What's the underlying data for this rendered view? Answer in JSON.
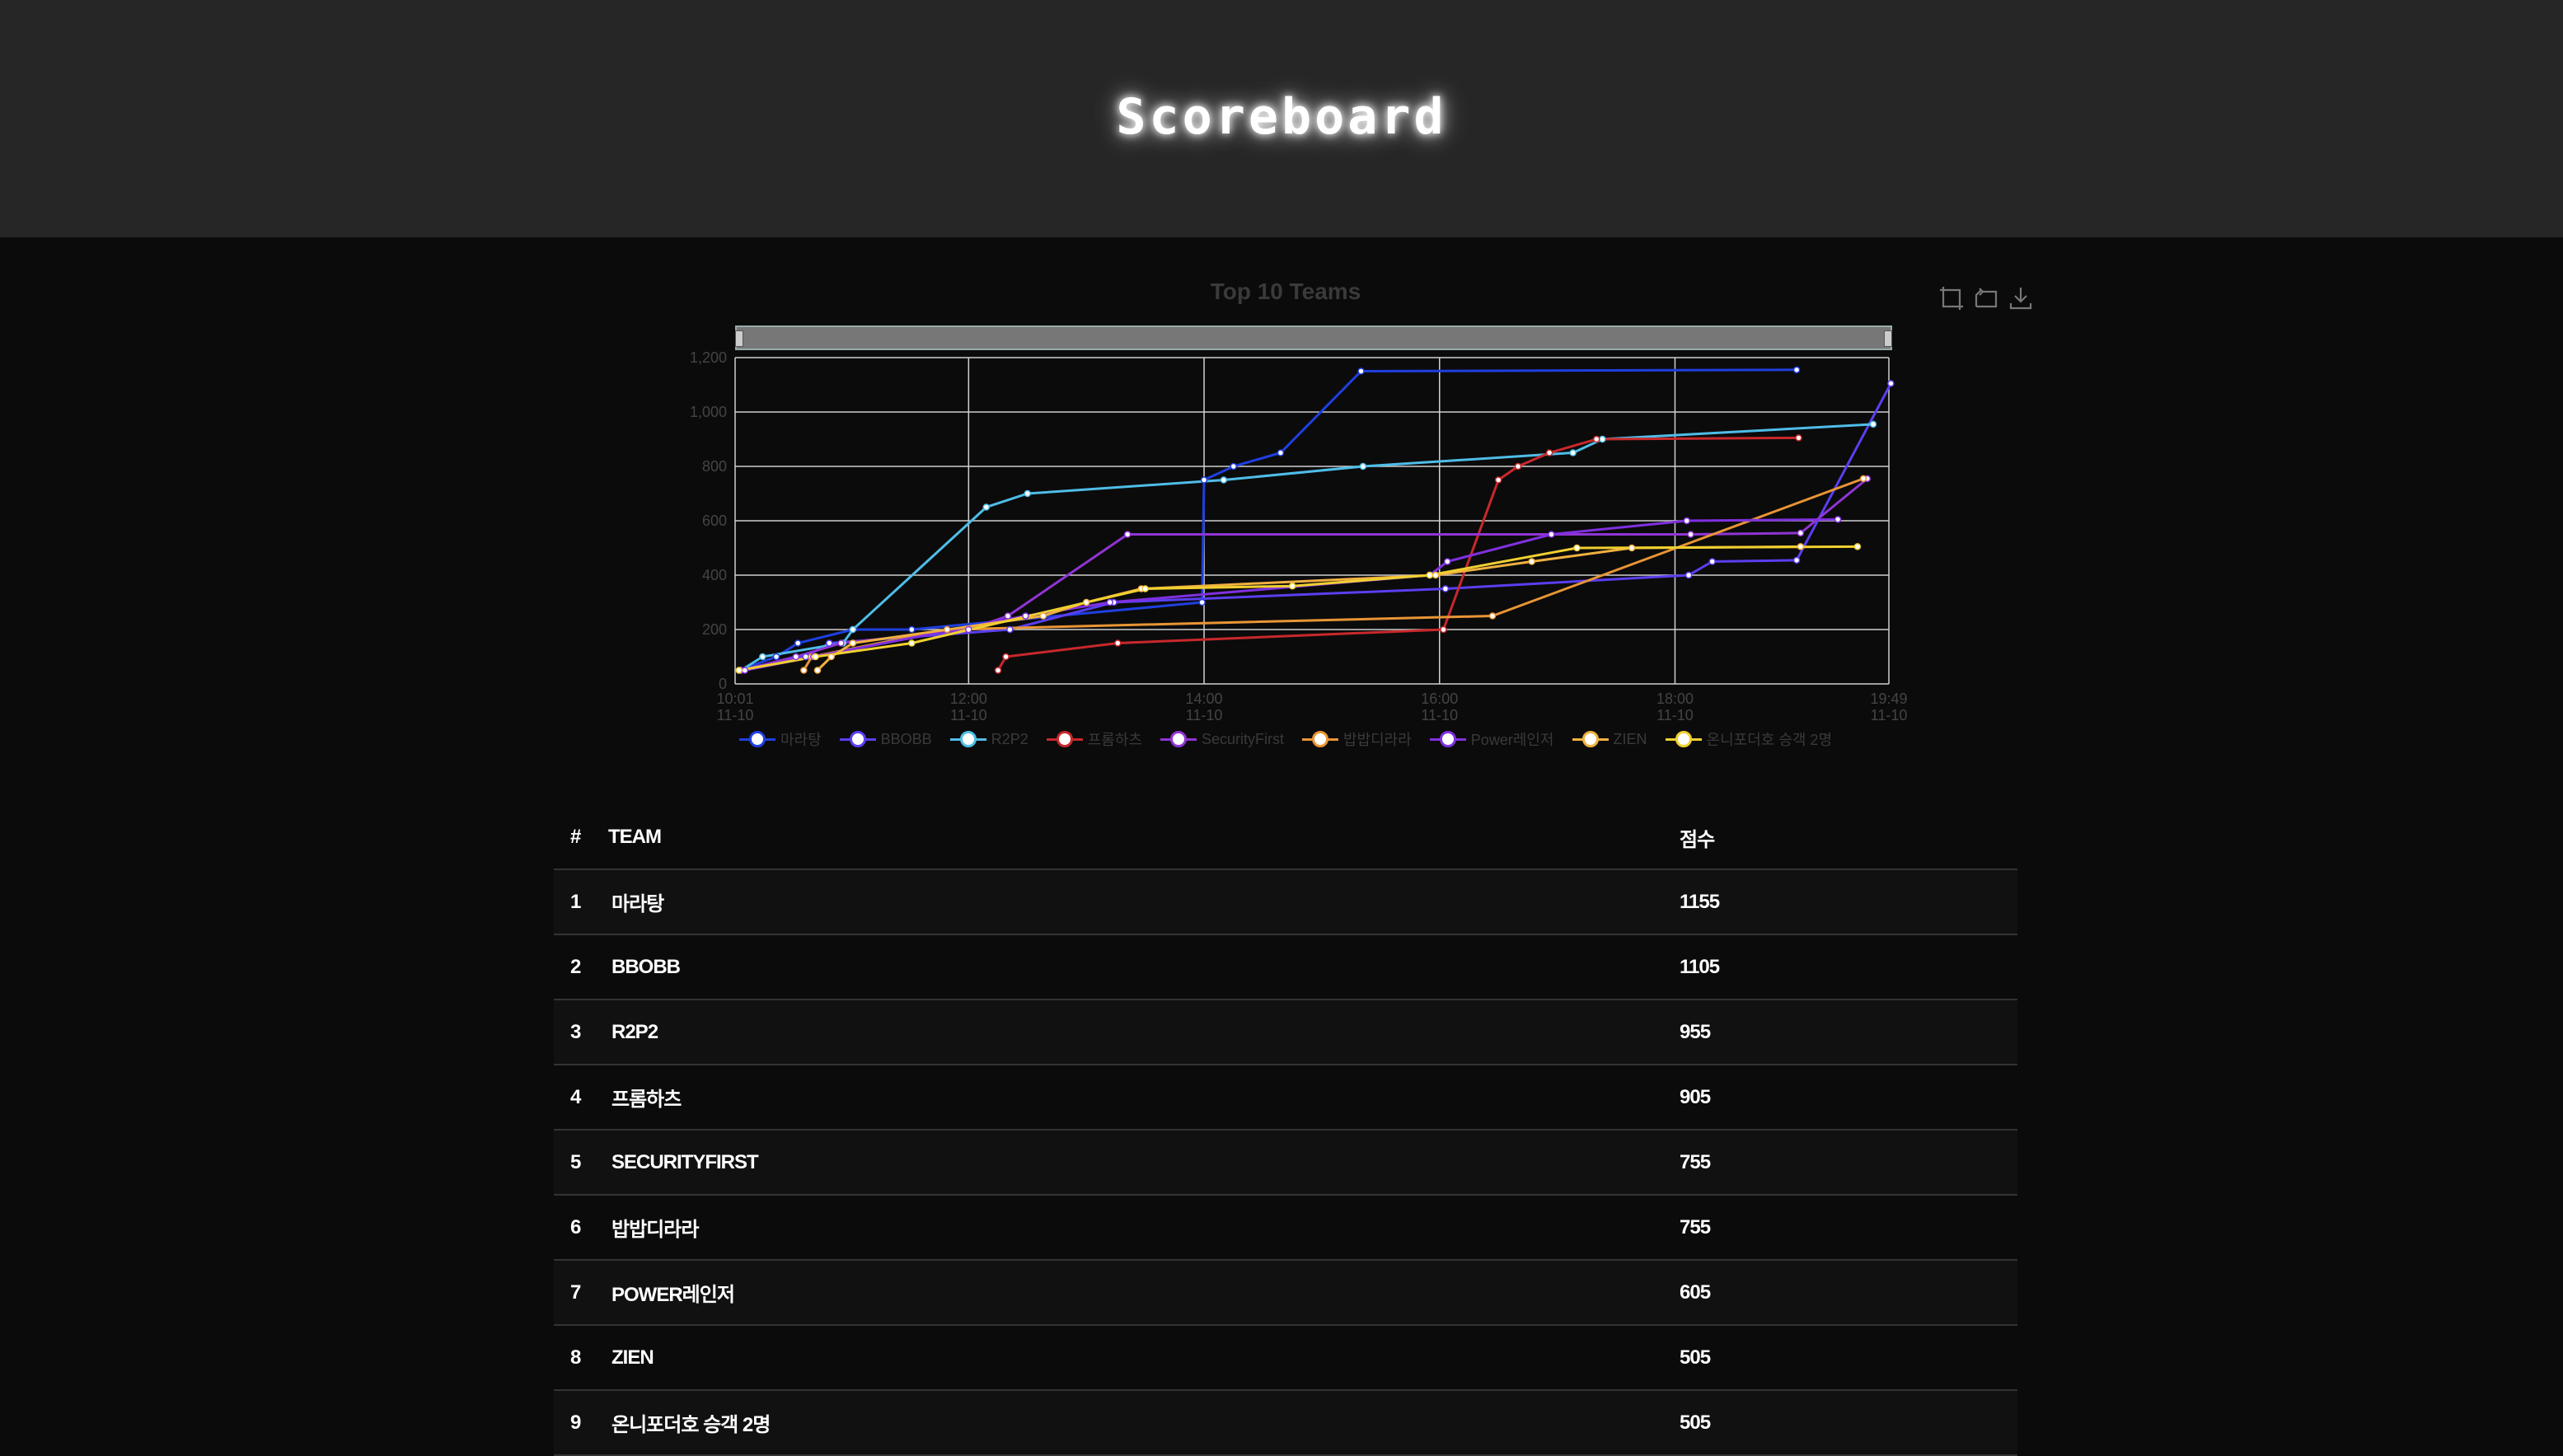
{
  "header": {
    "title": "Scoreboard"
  },
  "chart_data": {
    "type": "line",
    "title": "Top 10 Teams",
    "toolbox": [
      "zoom-icon",
      "zoom-reset-icon",
      "download-icon"
    ],
    "ylim": [
      0,
      1200
    ],
    "y_ticks": [
      "0",
      "200",
      "400",
      "600",
      "800",
      "1,000",
      "1,200"
    ],
    "x_ticks": [
      {
        "time": "10:01",
        "date": "11-10"
      },
      {
        "time": "12:00",
        "date": "11-10"
      },
      {
        "time": "14:00",
        "date": "11-10"
      },
      {
        "time": "16:00",
        "date": "11-10"
      },
      {
        "time": "18:00",
        "date": "11-10"
      },
      {
        "time": "19:49",
        "date": "11-10"
      }
    ],
    "grid": true,
    "legend_position": "bottom",
    "series": [
      {
        "name": "마라탕",
        "color": "#1f3fe0",
        "points": [
          [
            "10:03",
            50
          ],
          [
            "10:22",
            100
          ],
          [
            "10:33",
            150
          ],
          [
            "11:01",
            200
          ],
          [
            "11:31",
            200
          ],
          [
            "13:59",
            300
          ],
          [
            "14:00",
            750
          ],
          [
            "14:15",
            800
          ],
          [
            "14:39",
            850
          ],
          [
            "15:20",
            1150
          ],
          [
            "19:02",
            1155
          ]
        ]
      },
      {
        "name": "BBOBB",
        "color": "#5a3ff0",
        "points": [
          [
            "10:04",
            50
          ],
          [
            "10:37",
            100
          ],
          [
            "10:49",
            150
          ],
          [
            "12:21",
            200
          ],
          [
            "13:14",
            300
          ],
          [
            "16:03",
            350
          ],
          [
            "18:07",
            400
          ],
          [
            "18:19",
            450
          ],
          [
            "19:02",
            455
          ],
          [
            "19:50",
            1105
          ]
        ]
      },
      {
        "name": "R2P2",
        "color": "#4fbde8",
        "points": [
          [
            "10:04",
            50
          ],
          [
            "10:15",
            100
          ],
          [
            "10:56",
            150
          ],
          [
            "11:01",
            200
          ],
          [
            "12:09",
            650
          ],
          [
            "12:30",
            700
          ],
          [
            "14:10",
            750
          ],
          [
            "15:21",
            800
          ],
          [
            "17:08",
            850
          ],
          [
            "17:23",
            900
          ],
          [
            "19:41",
            955
          ]
        ]
      },
      {
        "name": "프롬하츠",
        "color": "#c8282c",
        "points": [
          [
            "12:15",
            50
          ],
          [
            "12:19",
            100
          ],
          [
            "13:16",
            150
          ],
          [
            "16:02",
            200
          ],
          [
            "16:30",
            750
          ],
          [
            "16:40",
            800
          ],
          [
            "16:56",
            850
          ],
          [
            "17:20",
            900
          ],
          [
            "19:03",
            905
          ]
        ]
      },
      {
        "name": "SecurityFirst",
        "color": "#9034d4",
        "points": [
          [
            "10:04",
            50
          ],
          [
            "10:32",
            100
          ],
          [
            "10:55",
            150
          ],
          [
            "12:00",
            200
          ],
          [
            "12:20",
            250
          ],
          [
            "13:21",
            550
          ],
          [
            "18:08",
            550
          ],
          [
            "19:04",
            555
          ],
          [
            "19:38",
            755
          ]
        ]
      },
      {
        "name": "밥밥디라라",
        "color": "#e89535",
        "points": [
          [
            "10:36",
            50
          ],
          [
            "10:40",
            100
          ],
          [
            "11:49",
            200
          ],
          [
            "16:27",
            250
          ],
          [
            "19:36",
            755
          ]
        ]
      },
      {
        "name": "Power레인저",
        "color": "#8030e0",
        "points": [
          [
            "10:06",
            50
          ],
          [
            "10:41",
            100
          ],
          [
            "12:29",
            250
          ],
          [
            "13:12",
            300
          ],
          [
            "15:55",
            400
          ],
          [
            "16:04",
            450
          ],
          [
            "16:57",
            550
          ],
          [
            "18:06",
            600
          ],
          [
            "19:23",
            605
          ]
        ]
      },
      {
        "name": "ZIEN",
        "color": "#f0b040",
        "points": [
          [
            "10:43",
            50
          ],
          [
            "10:50",
            100
          ],
          [
            "11:01",
            150
          ],
          [
            "12:38",
            250
          ],
          [
            "13:00",
            300
          ],
          [
            "13:28",
            350
          ],
          [
            "15:58",
            400
          ],
          [
            "16:47",
            450
          ],
          [
            "17:38",
            500
          ],
          [
            "19:04",
            505
          ]
        ]
      },
      {
        "name": "온니포더호 승객 2명",
        "color": "#f0d030",
        "points": [
          [
            "10:03",
            50
          ],
          [
            "10:42",
            100
          ],
          [
            "11:31",
            150
          ],
          [
            "13:30",
            350
          ],
          [
            "14:45",
            360
          ],
          [
            "15:55",
            400
          ],
          [
            "17:10",
            500
          ],
          [
            "19:33",
            505
          ]
        ]
      }
    ]
  },
  "scoreboard": {
    "headers": {
      "rank": "#",
      "team": "TEAM",
      "score": "점수"
    },
    "rows": [
      {
        "rank": "1",
        "team": "마라탕",
        "score": "1155"
      },
      {
        "rank": "2",
        "team": "BBOBB",
        "score": "1105"
      },
      {
        "rank": "3",
        "team": "R2P2",
        "score": "955"
      },
      {
        "rank": "4",
        "team": "프롬하츠",
        "score": "905"
      },
      {
        "rank": "5",
        "team": "SECURITYFIRST",
        "score": "755"
      },
      {
        "rank": "6",
        "team": "밥밥디라라",
        "score": "755"
      },
      {
        "rank": "7",
        "team": "POWER레인저",
        "score": "605"
      },
      {
        "rank": "8",
        "team": "ZIEN",
        "score": "505"
      },
      {
        "rank": "9",
        "team": "온니포더호 승객 2명",
        "score": "505"
      }
    ]
  }
}
